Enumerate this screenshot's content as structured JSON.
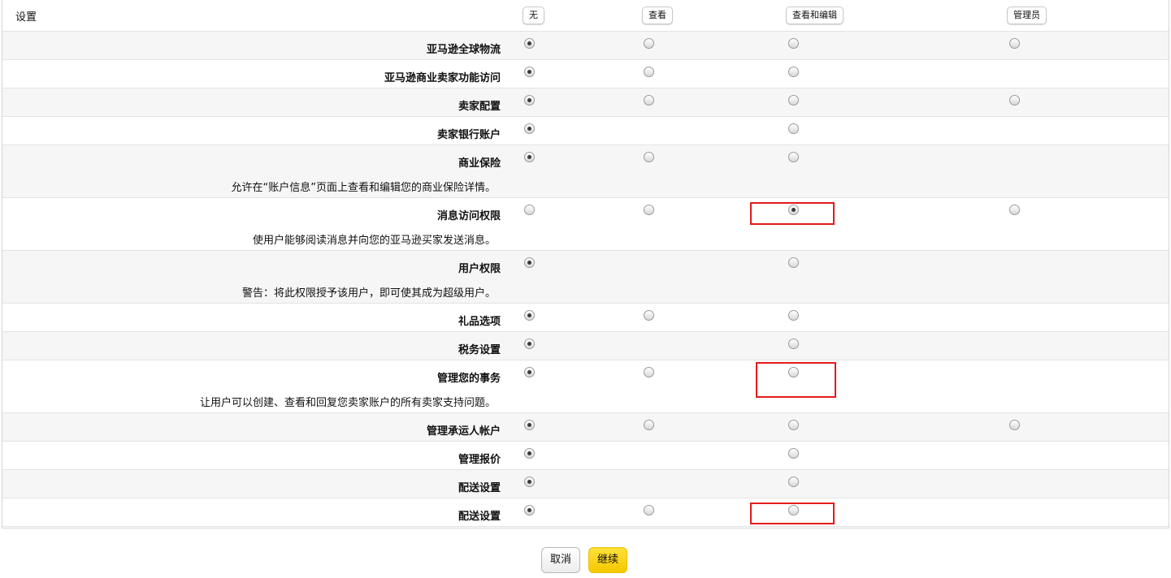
{
  "header": {
    "title": "设置",
    "columns": [
      "无",
      "查看",
      "查看和编辑",
      "管理员"
    ]
  },
  "rows": [
    {
      "label": "亚马逊全球物流",
      "options": [
        "none",
        "view",
        "view_edit",
        "admin"
      ],
      "selected": "none"
    },
    {
      "label": "亚马逊商业卖家功能访问",
      "options": [
        "none",
        "view",
        "view_edit"
      ],
      "selected": "none"
    },
    {
      "label": "卖家配置",
      "options": [
        "none",
        "view",
        "view_edit",
        "admin"
      ],
      "selected": "none"
    },
    {
      "label": "卖家银行账户",
      "options": [
        "none",
        "view_edit"
      ],
      "selected": "none"
    },
    {
      "label": "商业保险",
      "description": "允许在“账户信息”页面上查看和编辑您的商业保险详情。",
      "options": [
        "none",
        "view",
        "view_edit"
      ],
      "selected": "none"
    },
    {
      "label": "消息访问权限",
      "description": "使用户能够阅读消息并向您的亚马逊买家发送消息。",
      "options": [
        "none",
        "view",
        "view_edit",
        "admin"
      ],
      "selected": "view_edit",
      "highlighted": true
    },
    {
      "label": "用户权限",
      "description": "警告：将此权限授予该用户，即可使其成为超级用户。",
      "options": [
        "none",
        "view_edit"
      ],
      "selected": "none"
    },
    {
      "label": "礼品选项",
      "options": [
        "none",
        "view",
        "view_edit"
      ],
      "selected": "none"
    },
    {
      "label": "税务设置",
      "options": [
        "none",
        "view_edit"
      ],
      "selected": "none"
    },
    {
      "label": "管理您的事务",
      "description": "让用户可以创建、查看和回复您卖家账户的所有卖家支持问题。",
      "options": [
        "none",
        "view",
        "view_edit"
      ],
      "selected": "none",
      "highlighted": true
    },
    {
      "label": "管理承运人帐户",
      "options": [
        "none",
        "view",
        "view_edit",
        "admin"
      ],
      "selected": "none"
    },
    {
      "label": "管理报价",
      "options": [
        "none",
        "view_edit"
      ],
      "selected": "none"
    },
    {
      "label": "配送设置",
      "options": [
        "none",
        "view_edit"
      ],
      "selected": "none"
    },
    {
      "label": "配送设置",
      "options": [
        "none",
        "view",
        "view_edit"
      ],
      "selected": "none",
      "highlighted": true
    }
  ],
  "buttons": {
    "cancel": "取消",
    "continue": "继续"
  },
  "colors": {
    "highlight": "#e21b1b",
    "primary": "#ffd814",
    "row_alt": "#f6f6f6"
  }
}
